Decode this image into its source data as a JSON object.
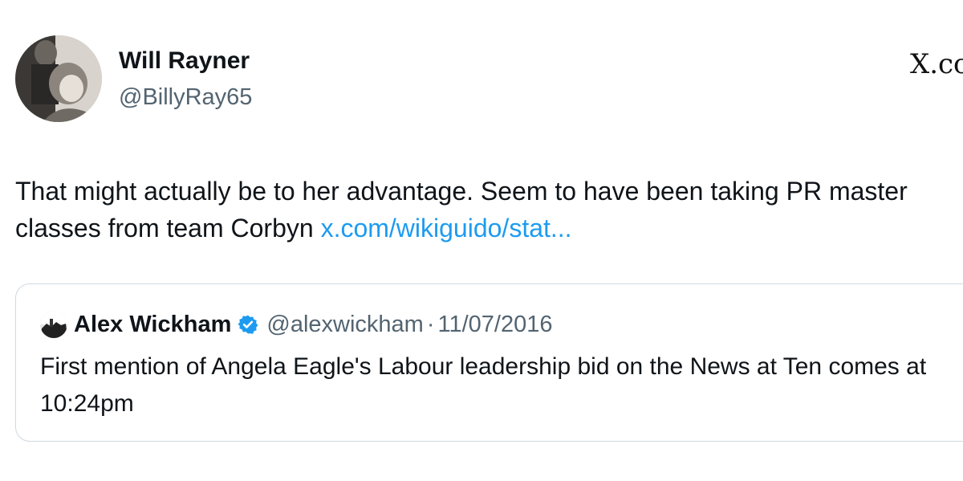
{
  "author": {
    "name": "Will Rayner",
    "handle": "@BillyRay65",
    "avatar_icon": "user-photo-avatar"
  },
  "source": {
    "label": "X.co"
  },
  "tweet": {
    "text": "That might actually be to her advantage. Seem to have been taking PR master classes from team Corbyn ",
    "link": "x.com/wikiguido/stat..."
  },
  "quote": {
    "name": "Alex Wickham",
    "verified_icon": "verified-badge-icon",
    "handle": "@alexwickham",
    "separator": "·",
    "date": "11/07/2016",
    "text": "First mention of Angela Eagle's Labour leadership bid on the News at Ten comes at 10:24pm"
  },
  "colors": {
    "link": "#1d9bf0",
    "secondary_text": "#536471",
    "border": "#cfd9de",
    "verified": "#1d9bf0"
  }
}
